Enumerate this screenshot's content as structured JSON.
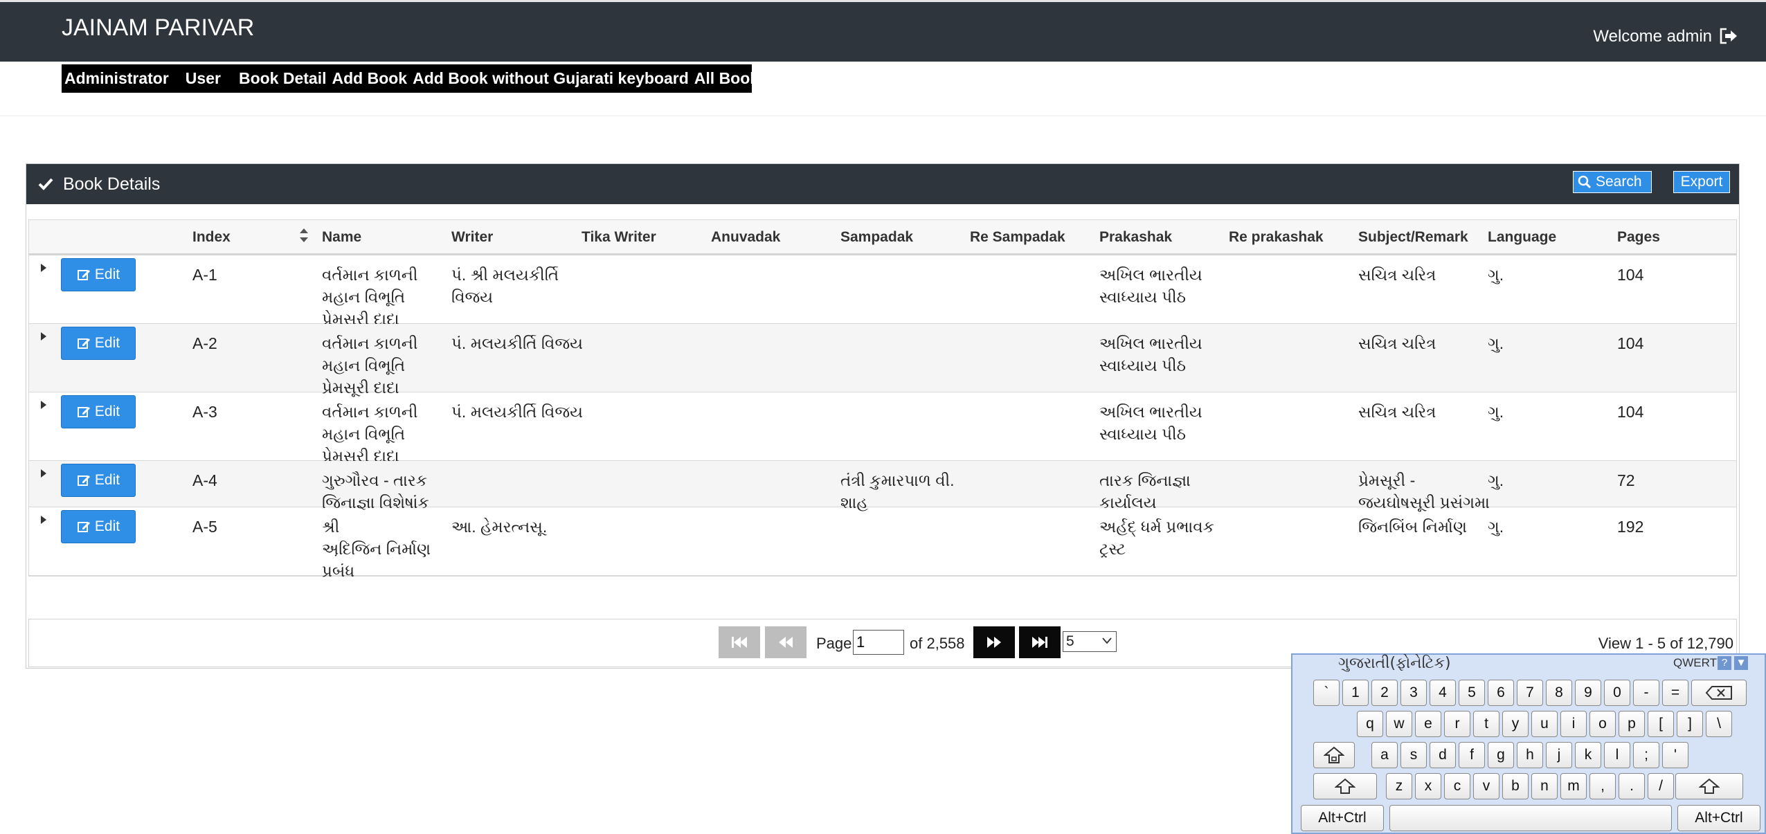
{
  "app": {
    "title": "JAINAM PARIVAR",
    "welcome": "Welcome admin"
  },
  "menu": [
    "Administrator",
    "User",
    "Book Detail",
    "Add Book",
    "Add Book without Gujarati keyboard",
    "All Books"
  ],
  "panel": {
    "title": "Book Details",
    "search_label": "Search",
    "export_label": "Export"
  },
  "table": {
    "columns": [
      "Index",
      "Name",
      "Writer",
      "Tika Writer",
      "Anuvadak",
      "Sampadak",
      "Re Sampadak",
      "Prakashak",
      "Re prakashak",
      "Subject/Remark",
      "Language",
      "Pages"
    ],
    "edit_label": "Edit",
    "rows": [
      {
        "index": "A-1",
        "name": [
          "વર્તમાન કાળની",
          "મહાન વિભૂતિ",
          "પ્રેમસૂરી દાદા"
        ],
        "writer": [
          "પં. શ્રી મલયકીર્તિ",
          "વિજય"
        ],
        "tika_writer": [],
        "anuvadak": [],
        "sampadak": [],
        "re_sampadak": [],
        "prakashak": [
          "અખિલ ભારતીય",
          "સ્વાધ્યાય પીઠ"
        ],
        "re_prakashak": [],
        "subject": [
          "સચિત્ર ચરિત્ર"
        ],
        "language": "ગુ.",
        "pages": "104"
      },
      {
        "index": "A-2",
        "name": [
          "વર્તમાન કાળની",
          "મહાન વિભૂતિ",
          "પ્રેમસૂરી દાદા"
        ],
        "writer": [
          "પં. મલયકીર્તિ વિજય"
        ],
        "tika_writer": [],
        "anuvadak": [],
        "sampadak": [],
        "re_sampadak": [],
        "prakashak": [
          "અખિલ ભારતીય",
          "સ્વાધ્યાય પીઠ"
        ],
        "re_prakashak": [],
        "subject": [
          "સચિત્ર ચરિત્ર"
        ],
        "language": "ગુ.",
        "pages": "104"
      },
      {
        "index": "A-3",
        "name": [
          "વર્તમાન કાળની",
          "મહાન વિભૂતિ",
          "પ્રેમસૂરી દાદા"
        ],
        "writer": [
          "પં. મલયકીર્તિ વિજય"
        ],
        "tika_writer": [],
        "anuvadak": [],
        "sampadak": [],
        "re_sampadak": [],
        "prakashak": [
          "અખિલ ભારતીય",
          "સ્વાધ્યાય પીઠ"
        ],
        "re_prakashak": [],
        "subject": [
          "સચિત્ર ચરિત્ર"
        ],
        "language": "ગુ.",
        "pages": "104"
      },
      {
        "index": "A-4",
        "name": [
          "ગુરુગૌરવ - તારક",
          "જિનાજ્ઞા વિશેષાંક"
        ],
        "writer": [],
        "tika_writer": [],
        "anuvadak": [],
        "sampadak": [
          "તંત્રી કુમારપાળ વી.",
          "શાહ"
        ],
        "re_sampadak": [],
        "prakashak": [
          "તારક જિનાજ્ઞા",
          "કાર્યાલય"
        ],
        "re_prakashak": [],
        "subject": [
          "પ્રેમસૂરી -",
          "જયઘોષસૂરી પ્રસંગમા"
        ],
        "language": "ગુ.",
        "pages": "72"
      },
      {
        "index": "A-5",
        "name": [
          "શ્રી",
          "અ઼દિજિન નિર્માણ",
          "પ્રબંધ"
        ],
        "writer": [
          "આ. હેમરત્નસૂ."
        ],
        "tika_writer": [],
        "anuvadak": [],
        "sampadak": [],
        "re_sampadak": [],
        "prakashak": [
          "અર્હદ્ ધર્મ પ્રભાવક",
          "ટ્રસ્ટ"
        ],
        "re_prakashak": [],
        "subject": [
          "જિનબિંબ નિર્માણ"
        ],
        "language": "ગુ.",
        "pages": "192"
      }
    ]
  },
  "pager": {
    "page_label": "Page",
    "page_value": "1",
    "of_label": "of 2,558",
    "page_size": "5",
    "view_info": "View 1 - 5 of 12,790"
  },
  "keyboard": {
    "title": "ગુજરાતી(ફોનેટિક)",
    "layout_label": "QWERTY",
    "help": "?",
    "row1": [
      "`",
      "1",
      "2",
      "3",
      "4",
      "5",
      "6",
      "7",
      "8",
      "9",
      "0",
      "-",
      "="
    ],
    "row2": [
      "q",
      "w",
      "e",
      "r",
      "t",
      "y",
      "u",
      "i",
      "o",
      "p",
      "[",
      "]",
      "\\"
    ],
    "row3": [
      "a",
      "s",
      "d",
      "f",
      "g",
      "h",
      "j",
      "k",
      "l",
      ";",
      "'"
    ],
    "row4": [
      "z",
      "x",
      "c",
      "v",
      "b",
      "n",
      "m",
      ",",
      ".",
      "/"
    ],
    "alt_ctrl": "Alt+Ctrl"
  },
  "colors": {
    "header_bg": "#2e353d",
    "accent_blue": "#2f8fe6",
    "menu_bg": "#000000",
    "keyboard_bg": "#d6e3f7"
  }
}
